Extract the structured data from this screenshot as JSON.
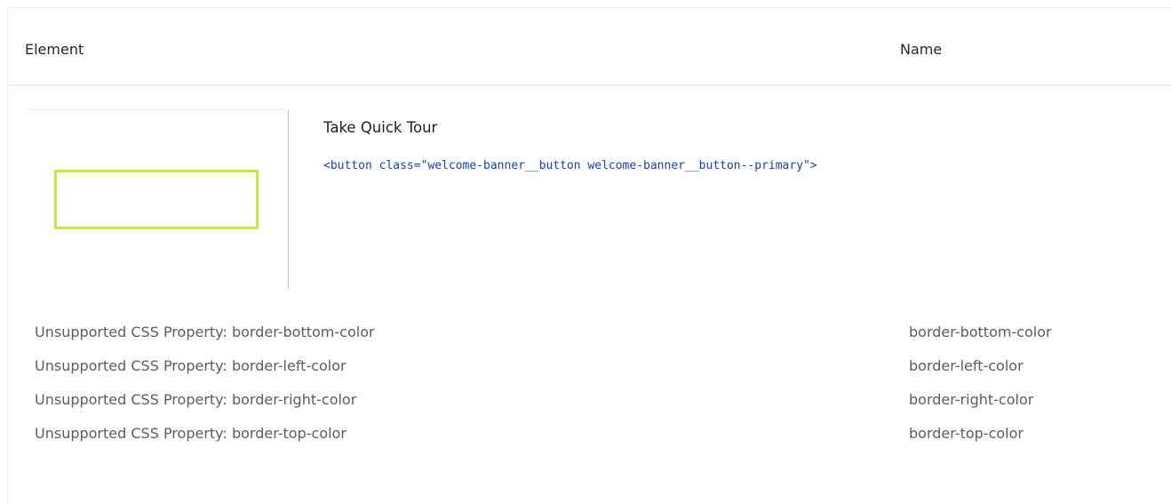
{
  "table": {
    "headers": {
      "element": "Element",
      "name": "Name"
    },
    "element": {
      "title": "Take Quick Tour",
      "code": "<button class=\"welcome-banner__button welcome-banner__button--primary\">",
      "highlight_color": "#d4df4f"
    },
    "issues": [
      {
        "text": "Unsupported CSS Property: border-bottom-color",
        "name": "border-bottom-color"
      },
      {
        "text": "Unsupported CSS Property: border-left-color",
        "name": "border-left-color"
      },
      {
        "text": "Unsupported CSS Property: border-right-color",
        "name": "border-right-color"
      },
      {
        "text": "Unsupported CSS Property: border-top-color",
        "name": "border-top-color"
      }
    ]
  },
  "colors": {
    "code_text": "#1a3fb0",
    "issue_text": "#5c5c5c",
    "divider": "#ececec"
  }
}
